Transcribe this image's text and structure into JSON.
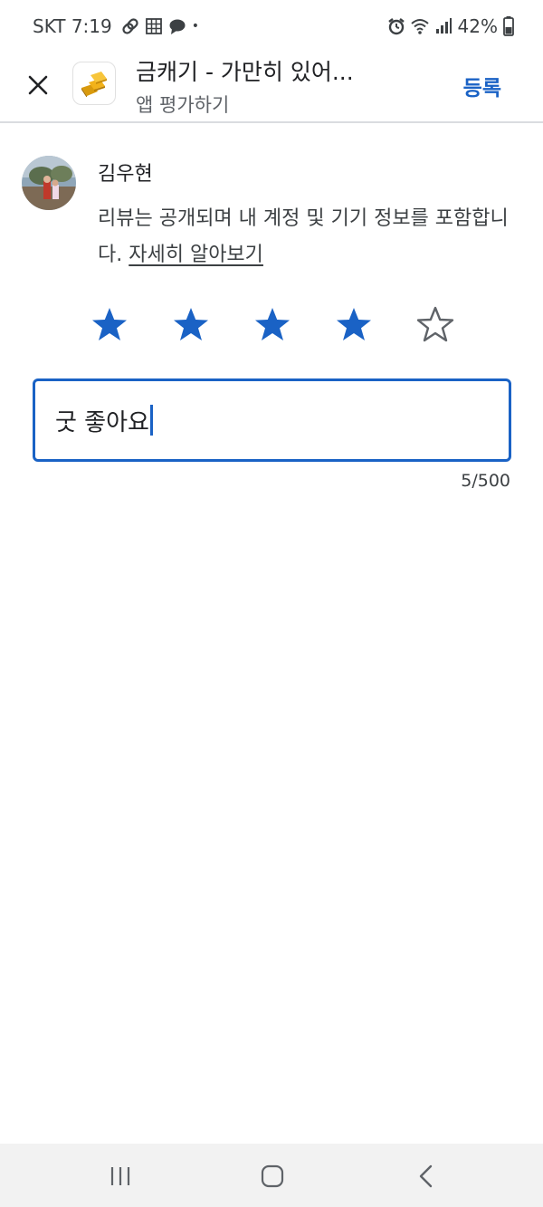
{
  "status_bar": {
    "carrier_time": "SKT 7:19",
    "dot": "•",
    "battery": "42%",
    "icons": [
      "link-icon",
      "sheet-icon",
      "chat-bubble-icon",
      "alarm-icon",
      "wifi-icon",
      "signal-icon",
      "battery-icon"
    ]
  },
  "app_bar": {
    "title": "금캐기 - 가만히 있어...",
    "subtitle": "앱 평가하기",
    "post_label": "등록",
    "close_icon": "close-icon",
    "app_icon": "gold-bars-icon"
  },
  "user": {
    "name": "김우현",
    "notice": "리뷰는 공개되며 내 계정 및 기기 정보를 포함합니다.",
    "learn_more": "자세히 알아보기"
  },
  "rating": {
    "value": 4,
    "max": 5,
    "filled_color": "#1a62c5",
    "empty_color": "#5f6368"
  },
  "review": {
    "value": "굿 좋아요",
    "char_count": "5/500"
  },
  "nav_bar": {
    "icons": [
      "recent-apps-icon",
      "home-icon",
      "back-icon"
    ]
  },
  "colors": {
    "accent": "#1a62c5",
    "divider": "#dadce0",
    "nav_bg": "#f2f2f2"
  }
}
